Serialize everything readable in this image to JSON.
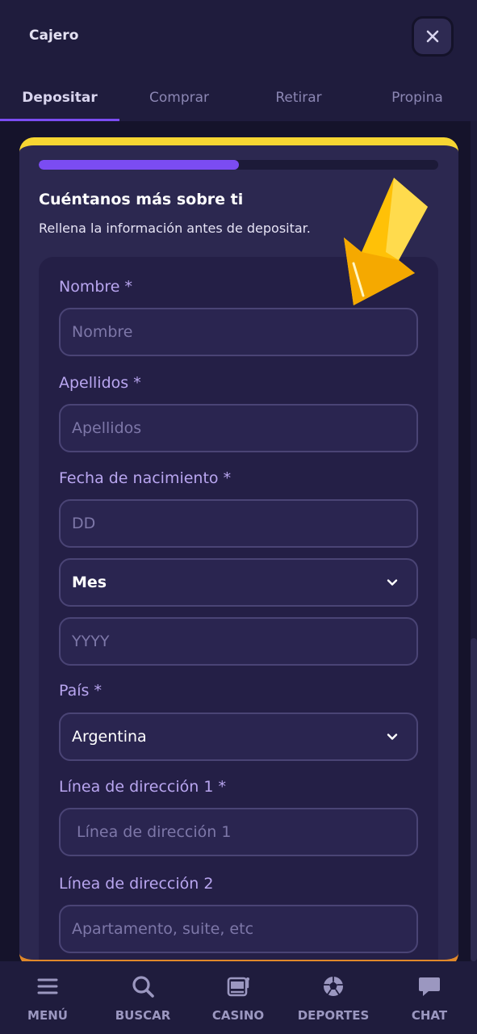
{
  "header": {
    "title": "Cajero",
    "close_icon": "close-icon"
  },
  "tabs": [
    {
      "label": "Depositar",
      "active": true
    },
    {
      "label": "Comprar",
      "active": false
    },
    {
      "label": "Retirar",
      "active": false
    },
    {
      "label": "Propina",
      "active": false
    }
  ],
  "progress": {
    "fraction": 0.5,
    "color": "#7b4cf2"
  },
  "card": {
    "title": "Cuéntanos más sobre ti",
    "subtitle": "Rellena la información antes de depositar."
  },
  "form": {
    "first_name": {
      "label": "Nombre *",
      "placeholder": "Nombre"
    },
    "last_name": {
      "label": "Apellidos *",
      "placeholder": "Apellidos"
    },
    "birth_date": {
      "label": "Fecha de nacimiento *",
      "day_placeholder": "DD",
      "month_value": "Mes",
      "year_placeholder": "YYYY"
    },
    "country": {
      "label": "País *",
      "value": "Argentina"
    },
    "address1": {
      "label": "Línea de dirección 1 *",
      "placeholder": "Línea de dirección 1"
    },
    "address2": {
      "label": "Línea de dirección 2",
      "placeholder": "Apartamento, suite, etc"
    }
  },
  "bottom_nav": [
    {
      "label": "MENÚ",
      "icon": "menu-icon"
    },
    {
      "label": "BUSCAR",
      "icon": "search-icon"
    },
    {
      "label": "CASINO",
      "icon": "slot-machine-icon"
    },
    {
      "label": "DEPORTES",
      "icon": "soccer-ball-icon"
    },
    {
      "label": "CHAT",
      "icon": "chat-bubble-icon"
    }
  ],
  "colors": {
    "accent": "#7b4cf2",
    "card_top": "#f7d632",
    "card_bottom": "#e0882a",
    "annotation_arrow": "#ffc107"
  }
}
